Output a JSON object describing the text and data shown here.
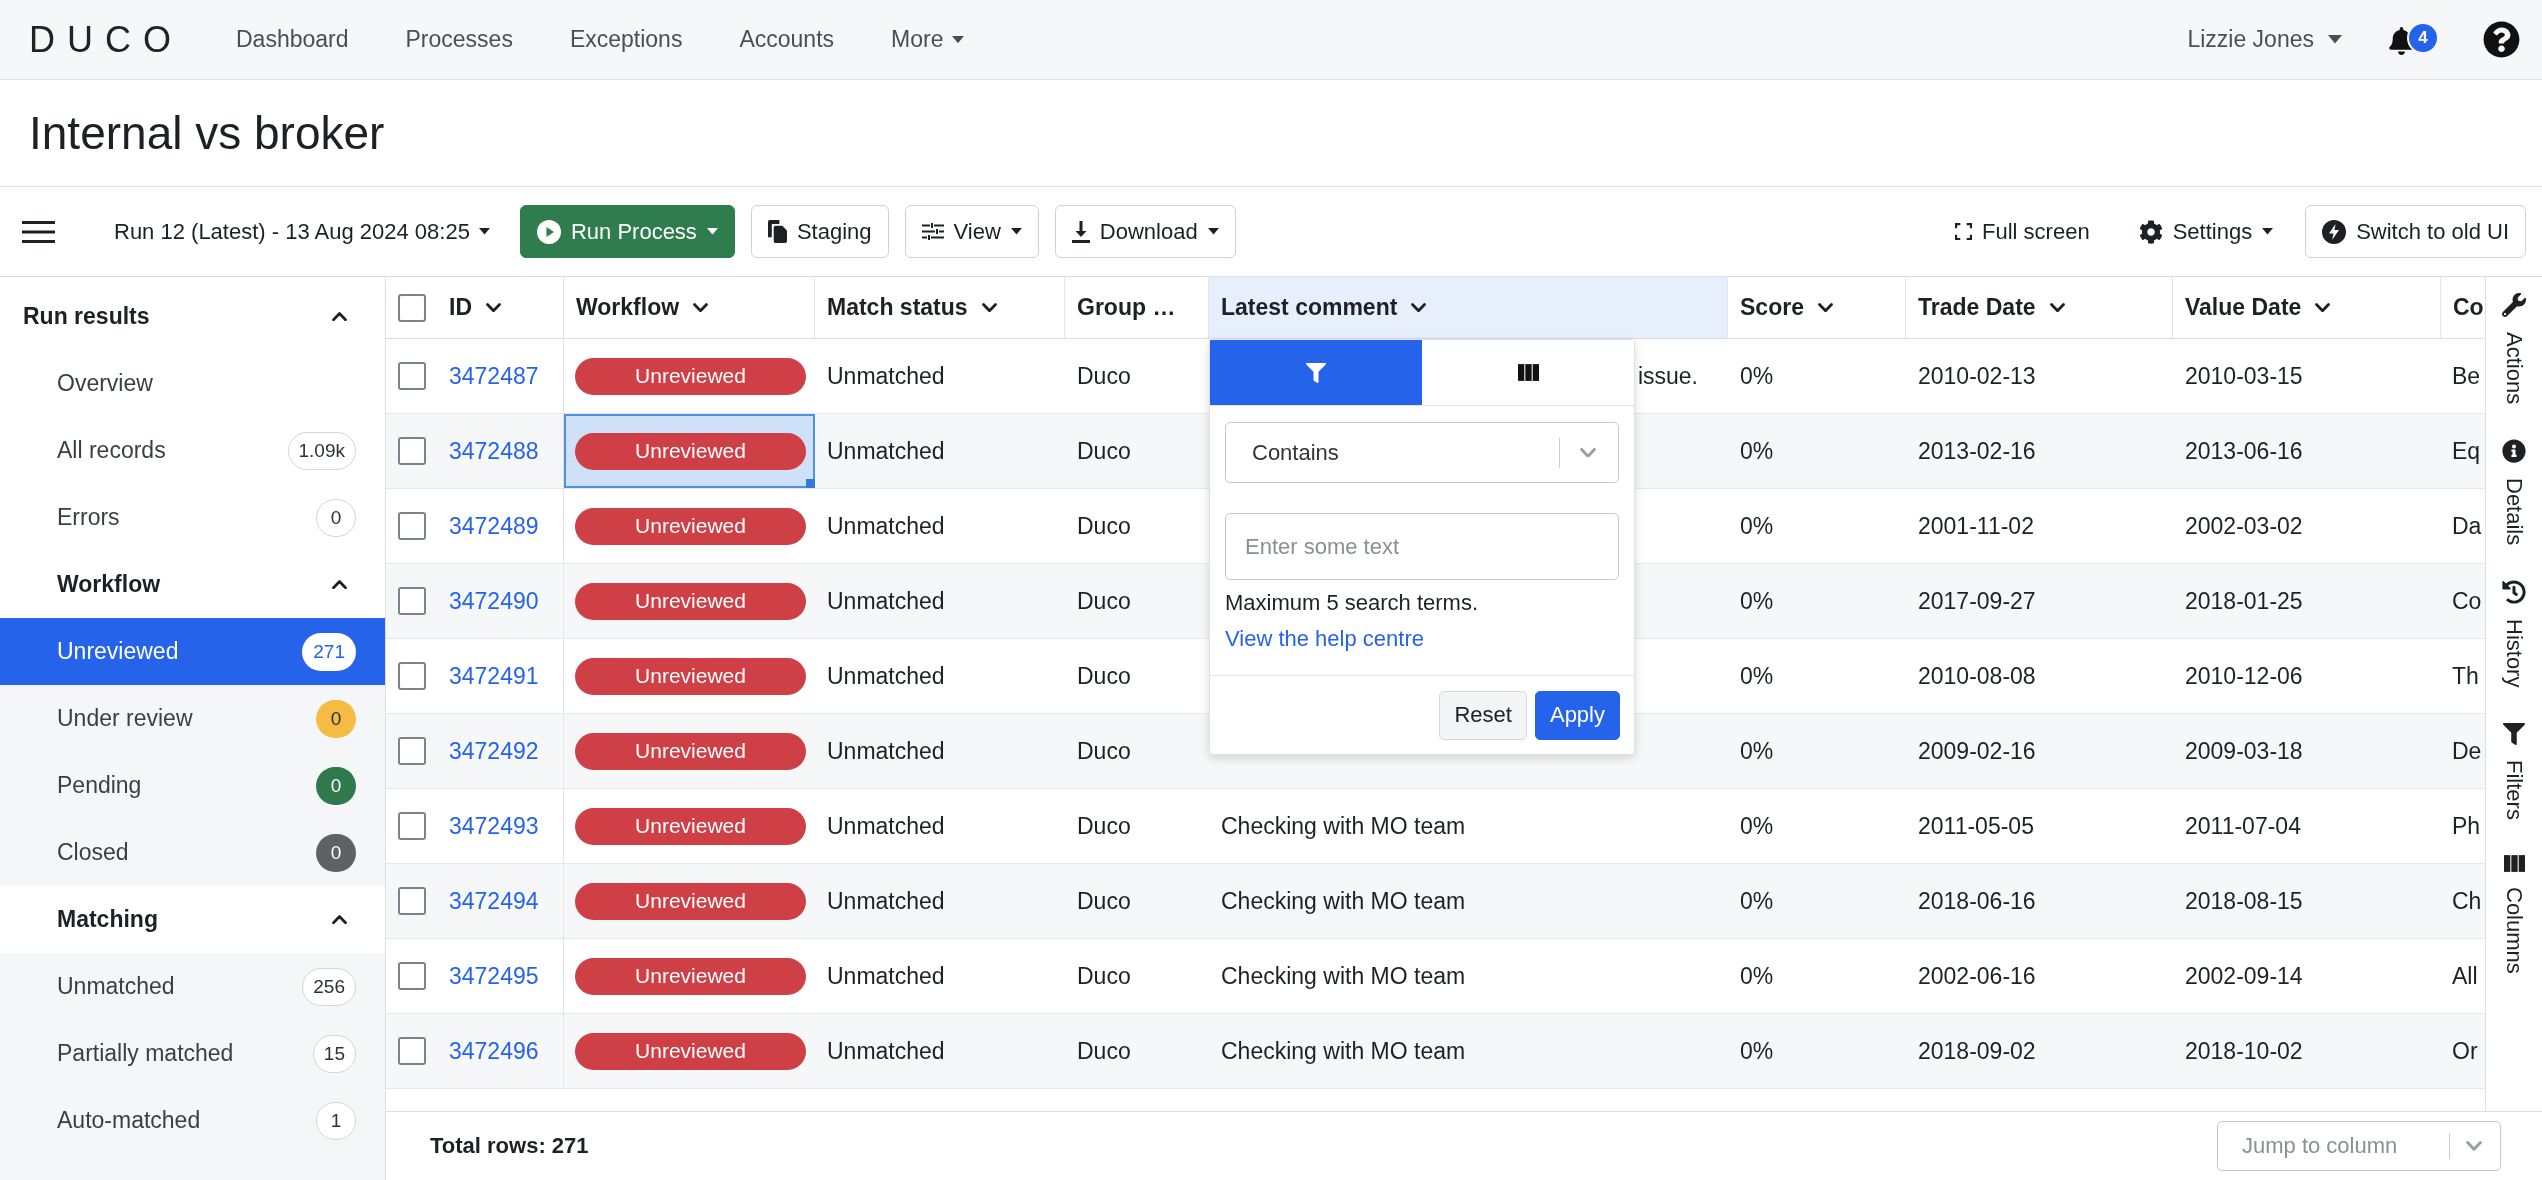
{
  "nav": {
    "logo": "DUCO",
    "items": [
      {
        "label": "Dashboard",
        "dropdown": false
      },
      {
        "label": "Processes",
        "dropdown": false
      },
      {
        "label": "Exceptions",
        "dropdown": false
      },
      {
        "label": "Accounts",
        "dropdown": false
      },
      {
        "label": "More",
        "dropdown": true
      }
    ],
    "user": "Lizzie Jones",
    "notifications": "4"
  },
  "page": {
    "title": "Internal vs broker"
  },
  "toolbar": {
    "run_selector": "Run 12 (Latest) - 13 Aug 2024 08:25",
    "left_buttons": [
      {
        "label": "Run Process",
        "kind": "primary",
        "dropdown": true
      },
      {
        "label": "Staging",
        "kind": "outline",
        "dropdown": false
      },
      {
        "label": "View",
        "kind": "outline",
        "dropdown": true
      },
      {
        "label": "Download",
        "kind": "outline",
        "dropdown": true
      }
    ],
    "right_buttons": [
      {
        "label": "Full screen",
        "kind": "plain",
        "dropdown": false
      },
      {
        "label": "Settings",
        "kind": "plain",
        "dropdown": true
      },
      {
        "label": "Switch to old UI",
        "kind": "outline",
        "dropdown": false
      }
    ]
  },
  "sidebar": {
    "kind": "section",
    "title": "Run results",
    "expanded": true,
    "children": [
      {
        "kind": "item",
        "label": "Overview",
        "selected": false
      },
      {
        "kind": "item",
        "label": "All records",
        "count": "1.09k",
        "selected": false
      },
      {
        "kind": "item",
        "label": "Errors",
        "count": "0",
        "selected": false
      },
      {
        "kind": "group",
        "title": "Workflow",
        "expanded": true,
        "children": [
          {
            "kind": "item",
            "label": "Unreviewed",
            "count": "271",
            "selected": true
          },
          {
            "kind": "item",
            "label": "Under review",
            "count": "0",
            "color": "#f5bb45",
            "selected": false
          },
          {
            "kind": "item",
            "label": "Pending",
            "count": "0",
            "color": "#2e7a4c",
            "selected": false
          },
          {
            "kind": "item",
            "label": "Closed",
            "count": "0",
            "color": "#5f6166",
            "selected": false
          }
        ]
      },
      {
        "kind": "group",
        "title": "Matching",
        "expanded": true,
        "children": [
          {
            "kind": "item",
            "label": "Unmatched",
            "count": "256",
            "selected": false
          },
          {
            "kind": "item",
            "label": "Partially matched",
            "count": "15",
            "selected": false
          },
          {
            "kind": "item",
            "label": "Auto-matched",
            "count": "1",
            "selected": false
          }
        ]
      }
    ]
  },
  "table": {
    "select_all_checked": false,
    "columns": [
      {
        "label": "ID",
        "menu": true,
        "active": false
      },
      {
        "label": "Workflow",
        "menu": true,
        "active": false
      },
      {
        "label": "Match status",
        "menu": true,
        "active": false
      },
      {
        "label": "Group …",
        "menu": false,
        "active": false
      },
      {
        "label": "Latest comment",
        "menu": true,
        "active": true
      },
      {
        "label": "Score",
        "menu": true,
        "active": false
      },
      {
        "label": "Trade Date",
        "menu": true,
        "active": false
      },
      {
        "label": "Value Date",
        "menu": true,
        "active": false
      },
      {
        "label": "Co",
        "active": false
      }
    ],
    "rows": [
      {
        "checked": false,
        "id": "3472487",
        "workflow": "Unreviewed",
        "cell_selected": false,
        "match_status": "Unmatched",
        "group": "Duco",
        "latest_comment": "issue.",
        "comment_partly_hidden": true,
        "score": "0%",
        "trade_date": "2010-02-13",
        "value_date": "2010-03-15",
        "column_9": "Be"
      },
      {
        "checked": false,
        "id": "3472488",
        "workflow": "Unreviewed",
        "cell_selected": true,
        "match_status": "Unmatched",
        "group": "Duco",
        "score": "0%",
        "trade_date": "2013-02-16",
        "value_date": "2013-06-16",
        "column_9": "Eq"
      },
      {
        "checked": false,
        "id": "3472489",
        "workflow": "Unreviewed",
        "cell_selected": false,
        "match_status": "Unmatched",
        "group": "Duco",
        "score": "0%",
        "trade_date": "2001-11-02",
        "value_date": "2002-03-02",
        "column_9": "Da"
      },
      {
        "checked": false,
        "id": "3472490",
        "workflow": "Unreviewed",
        "cell_selected": false,
        "match_status": "Unmatched",
        "group": "Duco",
        "score": "0%",
        "trade_date": "2017-09-27",
        "value_date": "2018-01-25",
        "column_9": "Co"
      },
      {
        "checked": false,
        "id": "3472491",
        "workflow": "Unreviewed",
        "cell_selected": false,
        "match_status": "Unmatched",
        "group": "Duco",
        "score": "0%",
        "trade_date": "2010-08-08",
        "value_date": "2010-12-06",
        "column_9": "Th"
      },
      {
        "checked": false,
        "id": "3472492",
        "workflow": "Unreviewed",
        "cell_selected": false,
        "match_status": "Unmatched",
        "group": "Duco",
        "score": "0%",
        "trade_date": "2009-02-16",
        "value_date": "2009-03-18",
        "column_9": "De"
      },
      {
        "checked": false,
        "id": "3472493",
        "workflow": "Unreviewed",
        "cell_selected": false,
        "match_status": "Unmatched",
        "group": "Duco",
        "latest_comment": "Checking with MO team",
        "comment_partly_hidden": false,
        "score": "0%",
        "trade_date": "2011-05-05",
        "value_date": "2011-07-04",
        "column_9": "Ph"
      },
      {
        "checked": false,
        "id": "3472494",
        "workflow": "Unreviewed",
        "cell_selected": false,
        "match_status": "Unmatched",
        "group": "Duco",
        "latest_comment": "Checking with MO team",
        "comment_partly_hidden": false,
        "score": "0%",
        "trade_date": "2018-06-16",
        "value_date": "2018-08-15",
        "column_9": "Ch"
      },
      {
        "checked": false,
        "id": "3472495",
        "workflow": "Unreviewed",
        "cell_selected": false,
        "match_status": "Unmatched",
        "group": "Duco",
        "latest_comment": "Checking with MO team",
        "comment_partly_hidden": false,
        "score": "0%",
        "trade_date": "2002-06-16",
        "value_date": "2002-09-14",
        "column_9": "All"
      },
      {
        "checked": false,
        "id": "3472496",
        "workflow": "Unreviewed",
        "cell_selected": false,
        "match_status": "Unmatched",
        "group": "Duco",
        "latest_comment": "Checking with MO team",
        "comment_partly_hidden": false,
        "score": "0%",
        "trade_date": "2018-09-02",
        "value_date": "2018-10-02",
        "column_9": "Or"
      }
    ]
  },
  "column_menu": {
    "tabs": [
      {
        "kind": "filter",
        "selected": true
      },
      {
        "kind": "columns",
        "selected": false
      }
    ],
    "operator": "Contains",
    "placeholder": "Enter some text",
    "hint": "Maximum 5 search terms.",
    "link": "View the help centre",
    "buttons": [
      {
        "label": "Reset",
        "kind": "reset"
      },
      {
        "label": "Apply",
        "kind": "apply"
      }
    ]
  },
  "side_panel_tabs": [
    {
      "label": "Actions"
    },
    {
      "label": "Details"
    },
    {
      "label": "History"
    },
    {
      "label": "Filters"
    },
    {
      "label": "Columns"
    }
  ],
  "footer": {
    "total_rows": "Total rows: 271",
    "jump_placeholder": "Jump to column"
  }
}
